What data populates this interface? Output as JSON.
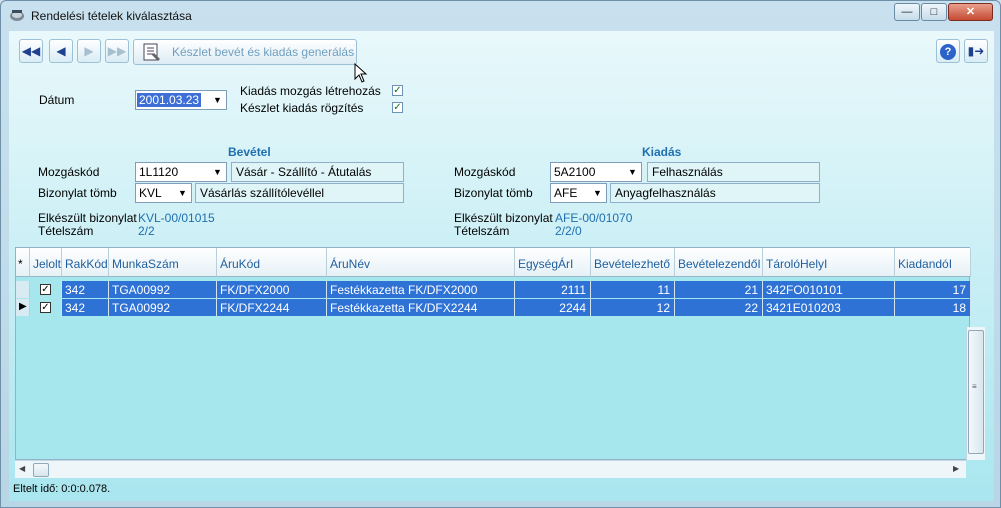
{
  "window": {
    "title": "Rendelési tételek kiválasztása",
    "minimize_icon": "minimize-icon",
    "maximize_icon": "maximize-icon",
    "close_icon": "close-icon"
  },
  "toolbar": {
    "first_icon": "first-record-icon",
    "prev_icon": "previous-record-icon",
    "next_icon": "next-record-icon",
    "last_icon": "last-record-icon",
    "generate_label": "Készlet bevét és kiadás generálás",
    "help_icon": "help-icon",
    "exit_icon": "exit-icon"
  },
  "form": {
    "date_label": "Dátum",
    "date_value": "2001.03.23",
    "checkbox1_label": "Kiadás mozgás létrehozás",
    "checkbox1_checked": true,
    "checkbox2_label": "Készlet kiadás rögzítés",
    "checkbox2_checked": true
  },
  "income": {
    "title": "Bevétel",
    "movement_code_label": "Mozgáskód",
    "movement_code_value": "1L1120",
    "movement_code_desc": "Vásár - Szállító - Átutalás",
    "doc_block_label": "Bizonylat tömb",
    "doc_block_value": "KVL",
    "doc_block_desc": "Vásárlás szállítólevéllel",
    "completed_doc_label": "Elkészült bizonylat",
    "completed_doc_value": "KVL-00/01015",
    "item_count_label": "Tételszám",
    "item_count_value": "2/2"
  },
  "expense": {
    "title": "Kiadás",
    "movement_code_label": "Mozgáskód",
    "movement_code_value": "5A2100",
    "movement_code_desc": "Felhasználás",
    "doc_block_label": "Bizonylat tömb",
    "doc_block_value": "AFE",
    "doc_block_desc": "Anyagfelhasználás",
    "completed_doc_label": "Elkészült bizonylat",
    "completed_doc_value": "AFE-00/01070",
    "item_count_label": "Tételszám",
    "item_count_value": "2/2/0"
  },
  "grid": {
    "indicator_header": "*",
    "columns": [
      "Jelolt",
      "RakKód",
      "MunkaSzám",
      "ÁruKód",
      "ÁruNév",
      "EgységÁrI",
      "Bevételezhető",
      "BevételezendőI",
      "TárolóHelyI",
      "KiadandóI"
    ],
    "rows": [
      {
        "checked": true,
        "RakKod": "342",
        "MunkaSzam": "TGA00992",
        "AruKod": "FK/DFX2000",
        "AruNev": "Festékkazetta FK/DFX2000",
        "EgysegArI": "2111",
        "Bevetelezheto": "11",
        "BevetelezendoI": "21",
        "TaroloHelyI": "342FO010101",
        "KiadandoI": "17"
      },
      {
        "checked": true,
        "current": true,
        "RakKod": "342",
        "MunkaSzam": "TGA00992",
        "AruKod": "FK/DFX2244",
        "AruNev": "Festékkazetta FK/DFX2244",
        "EgysegArI": "2244",
        "Bevetelezheto": "12",
        "BevetelezendoI": "22",
        "TaroloHelyI": "3421E010203",
        "KiadandoI": "18"
      }
    ]
  },
  "status": {
    "elapsed": "Eltelt idő: 0:0:0.078."
  }
}
